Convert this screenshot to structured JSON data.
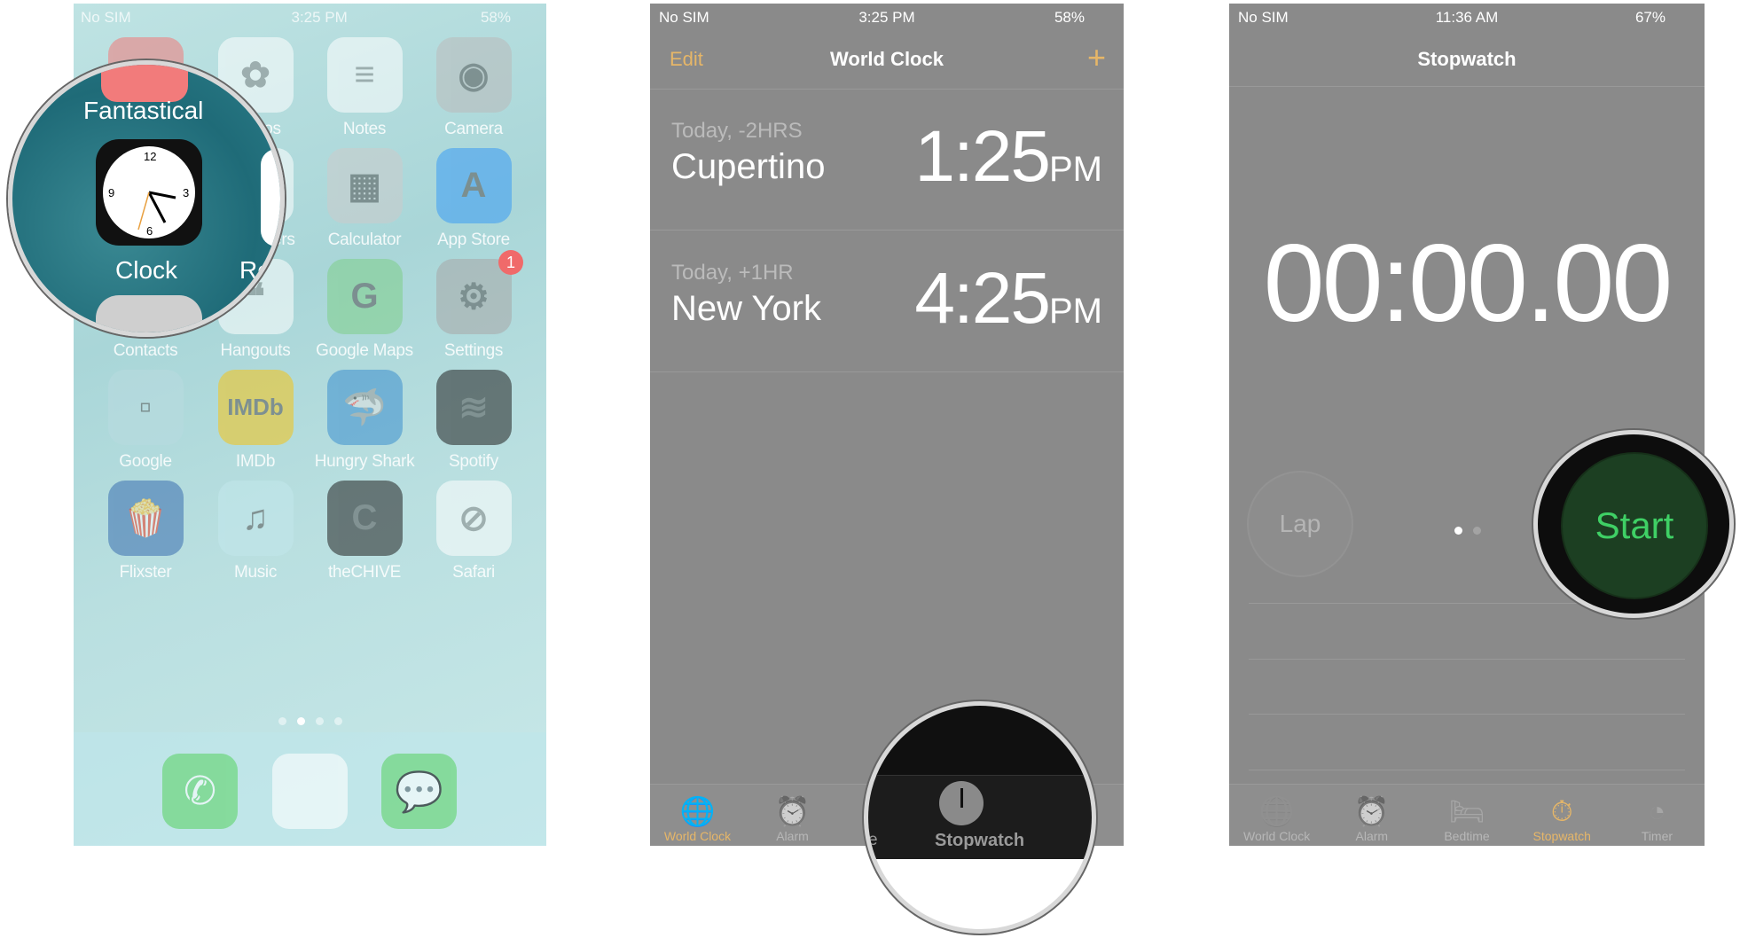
{
  "home": {
    "status": {
      "carrier": "No SIM",
      "time": "3:25 PM",
      "battery": "58%"
    },
    "apps": [
      {
        "label": "Fantastical",
        "color": "#f27b7b",
        "glyph": "▤"
      },
      {
        "label": "Photos",
        "color": "#ffffff",
        "glyph": "✿"
      },
      {
        "label": "Notes",
        "color": "#ffffff",
        "glyph": "≡"
      },
      {
        "label": "Camera",
        "color": "#bbbbbb",
        "glyph": "◉"
      },
      {
        "label": "Clock",
        "color": "#111111",
        "glyph": "◷"
      },
      {
        "label": "Reminders",
        "color": "#ffffff",
        "glyph": "⋮"
      },
      {
        "label": "Calculator",
        "color": "#cccccc",
        "glyph": "▦"
      },
      {
        "label": "App Store",
        "color": "#3b9cf5",
        "glyph": "A"
      },
      {
        "label": "Contacts",
        "color": "#cfcfcf",
        "glyph": "☺"
      },
      {
        "label": "Hangouts",
        "color": "#ffffff",
        "glyph": "❝"
      },
      {
        "label": "Google Maps",
        "color": "#7fcf8a",
        "glyph": "G"
      },
      {
        "label": "Settings",
        "color": "#a8a8a8",
        "glyph": "⚙",
        "badge": "1"
      },
      {
        "label": "Google",
        "color": "#b9dbe0",
        "glyph": "▫"
      },
      {
        "label": "IMDb",
        "color": "#f5c518",
        "glyph": "IMDb"
      },
      {
        "label": "Hungry Shark",
        "color": "#3c8fcf",
        "glyph": "🦈"
      },
      {
        "label": "Spotify",
        "color": "#222222",
        "glyph": "≋"
      },
      {
        "label": "Flixster",
        "color": "#3b6fb0",
        "glyph": "🍿"
      },
      {
        "label": "Music",
        "color": "#c3e8ec",
        "glyph": "♫"
      },
      {
        "label": "theCHIVE",
        "color": "#222222",
        "glyph": "C"
      },
      {
        "label": "Safari",
        "color": "#ffffff",
        "glyph": "⊘"
      }
    ],
    "page_dots": 4,
    "active_page": 2,
    "dock": [
      {
        "name": "phone",
        "color": "#5fd36a",
        "glyph": "✆"
      },
      {
        "name": "chrome",
        "color": "#ffffff",
        "glyph": "◍"
      },
      {
        "name": "messages",
        "color": "#5fd36a",
        "glyph": "💬"
      }
    ],
    "magnifier": {
      "top_label": "Fantastical",
      "icon_label": "Clock",
      "partial_label": "Re"
    }
  },
  "world_clock": {
    "status": {
      "carrier": "No SIM",
      "time": "3:25 PM",
      "battery": "58%"
    },
    "edit": "Edit",
    "title": "World Clock",
    "add": "+",
    "clocks": [
      {
        "offset": "Today, -2HRS",
        "city": "Cupertino",
        "time": "1:25",
        "ampm": "PM"
      },
      {
        "offset": "Today, +1HR",
        "city": "New York",
        "time": "4:25",
        "ampm": "PM"
      }
    ],
    "tabs": [
      {
        "label": "World Clock",
        "icon": "globe-icon",
        "glyph": "🌐"
      },
      {
        "label": "Alarm",
        "icon": "alarm-icon",
        "glyph": "⏰"
      }
    ],
    "magnifier": {
      "label": "Stopwatch",
      "partial": "e"
    },
    "accent": "#e6b668"
  },
  "stopwatch": {
    "status": {
      "carrier": "No SIM",
      "time": "11:36 AM",
      "battery": "67%"
    },
    "title": "Stopwatch",
    "time": "00:00.00",
    "lap": "Lap",
    "start": "Start",
    "tabs": [
      {
        "label": "World Clock",
        "glyph": "🌐",
        "icon": "globe-icon"
      },
      {
        "label": "Alarm",
        "glyph": "⏰",
        "icon": "alarm-icon"
      },
      {
        "label": "Bedtime",
        "glyph": "🛏",
        "icon": "bed-icon"
      },
      {
        "label": "Stopwatch",
        "glyph": "⏱",
        "icon": "stopwatch-icon"
      },
      {
        "label": "Timer",
        "glyph": "◔",
        "icon": "timer-icon"
      }
    ],
    "active_tab": 3,
    "start_color": "#3fd065"
  }
}
